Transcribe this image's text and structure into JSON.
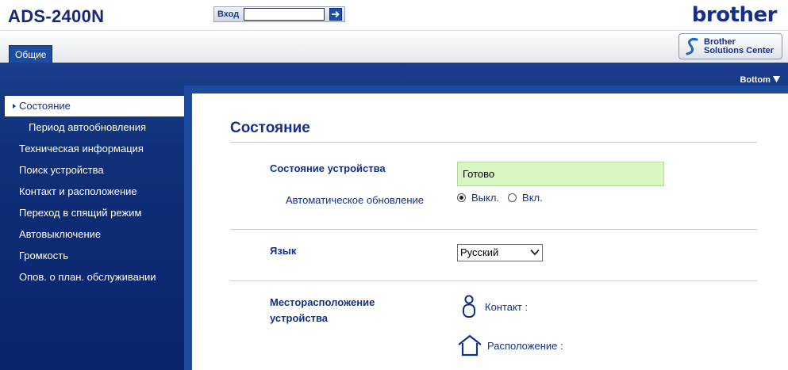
{
  "header": {
    "model": "ADS-2400N",
    "login_label": "Вход",
    "login_value": "",
    "brand": "brother"
  },
  "tabs": [
    {
      "label": "Общие",
      "active": true
    }
  ],
  "solutions_center": {
    "line1": "Brother",
    "line2": "Solutions Center"
  },
  "bottom_link": "Bottom",
  "sidebar": {
    "items": [
      {
        "label": "Состояние",
        "active": true,
        "sub": false
      },
      {
        "label": "Период автообновления",
        "active": false,
        "sub": true
      },
      {
        "label": "Техническая информация",
        "active": false,
        "sub": false
      },
      {
        "label": "Поиск устройства",
        "active": false,
        "sub": false
      },
      {
        "label": "Контакт и расположение",
        "active": false,
        "sub": false
      },
      {
        "label": "Переход в спящий режим",
        "active": false,
        "sub": false
      },
      {
        "label": "Автовыключение",
        "active": false,
        "sub": false
      },
      {
        "label": "Громкость",
        "active": false,
        "sub": false
      },
      {
        "label": "Опов. о план. обслуживании",
        "active": false,
        "sub": false
      }
    ]
  },
  "main": {
    "title": "Состояние",
    "device_status": {
      "label": "Состояние устройства",
      "value": "Готово",
      "value_bg": "#d9f5c4"
    },
    "auto_refresh": {
      "label": "Автоматическое обновление",
      "options": [
        {
          "label": "Выкл.",
          "checked": true
        },
        {
          "label": "Вкл.",
          "checked": false
        }
      ]
    },
    "language": {
      "label": "Язык",
      "selected": "Русский"
    },
    "location": {
      "label_line1": "Месторасположение",
      "label_line2": "устройства",
      "contact_label": "Контакт :",
      "contact_value": "",
      "location_label": "Расположение :",
      "location_value": ""
    }
  },
  "colors": {
    "brand_blue": "#14308a",
    "band_blue": "#0f2f78",
    "status_green": "#d9f5c4"
  }
}
